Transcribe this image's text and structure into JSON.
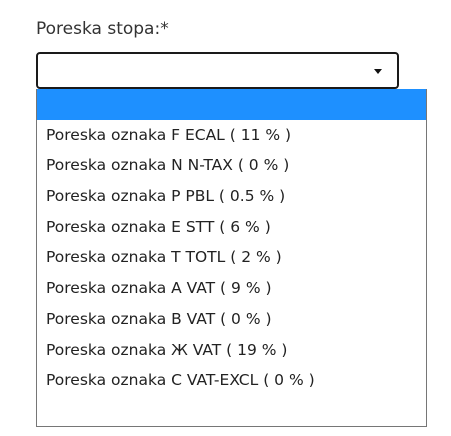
{
  "field": {
    "label": "Poreska stopa:*",
    "selected_value": ""
  },
  "dropdown": {
    "arrow_icon": "triangle-down-icon",
    "options": [
      {
        "label": "",
        "highlighted": true
      },
      {
        "label": "Poreska oznaka F ECAL ( 11 % )"
      },
      {
        "label": "Poreska oznaka N N-TAX ( 0 % )"
      },
      {
        "label": "Poreska oznaka P PBL ( 0.5 % )"
      },
      {
        "label": "Poreska oznaka E STT ( 6 % )"
      },
      {
        "label": "Poreska oznaka T TOTL ( 2 % )"
      },
      {
        "label": "Poreska oznaka A VAT ( 9 % )"
      },
      {
        "label": "Poreska oznaka B VAT ( 0 % )"
      },
      {
        "label": "Poreska oznaka Ж VAT ( 19 % )"
      },
      {
        "label": "Poreska oznaka C VAT-EXCL ( 0 % )"
      }
    ]
  },
  "colors": {
    "highlight": "#1e90ff"
  }
}
